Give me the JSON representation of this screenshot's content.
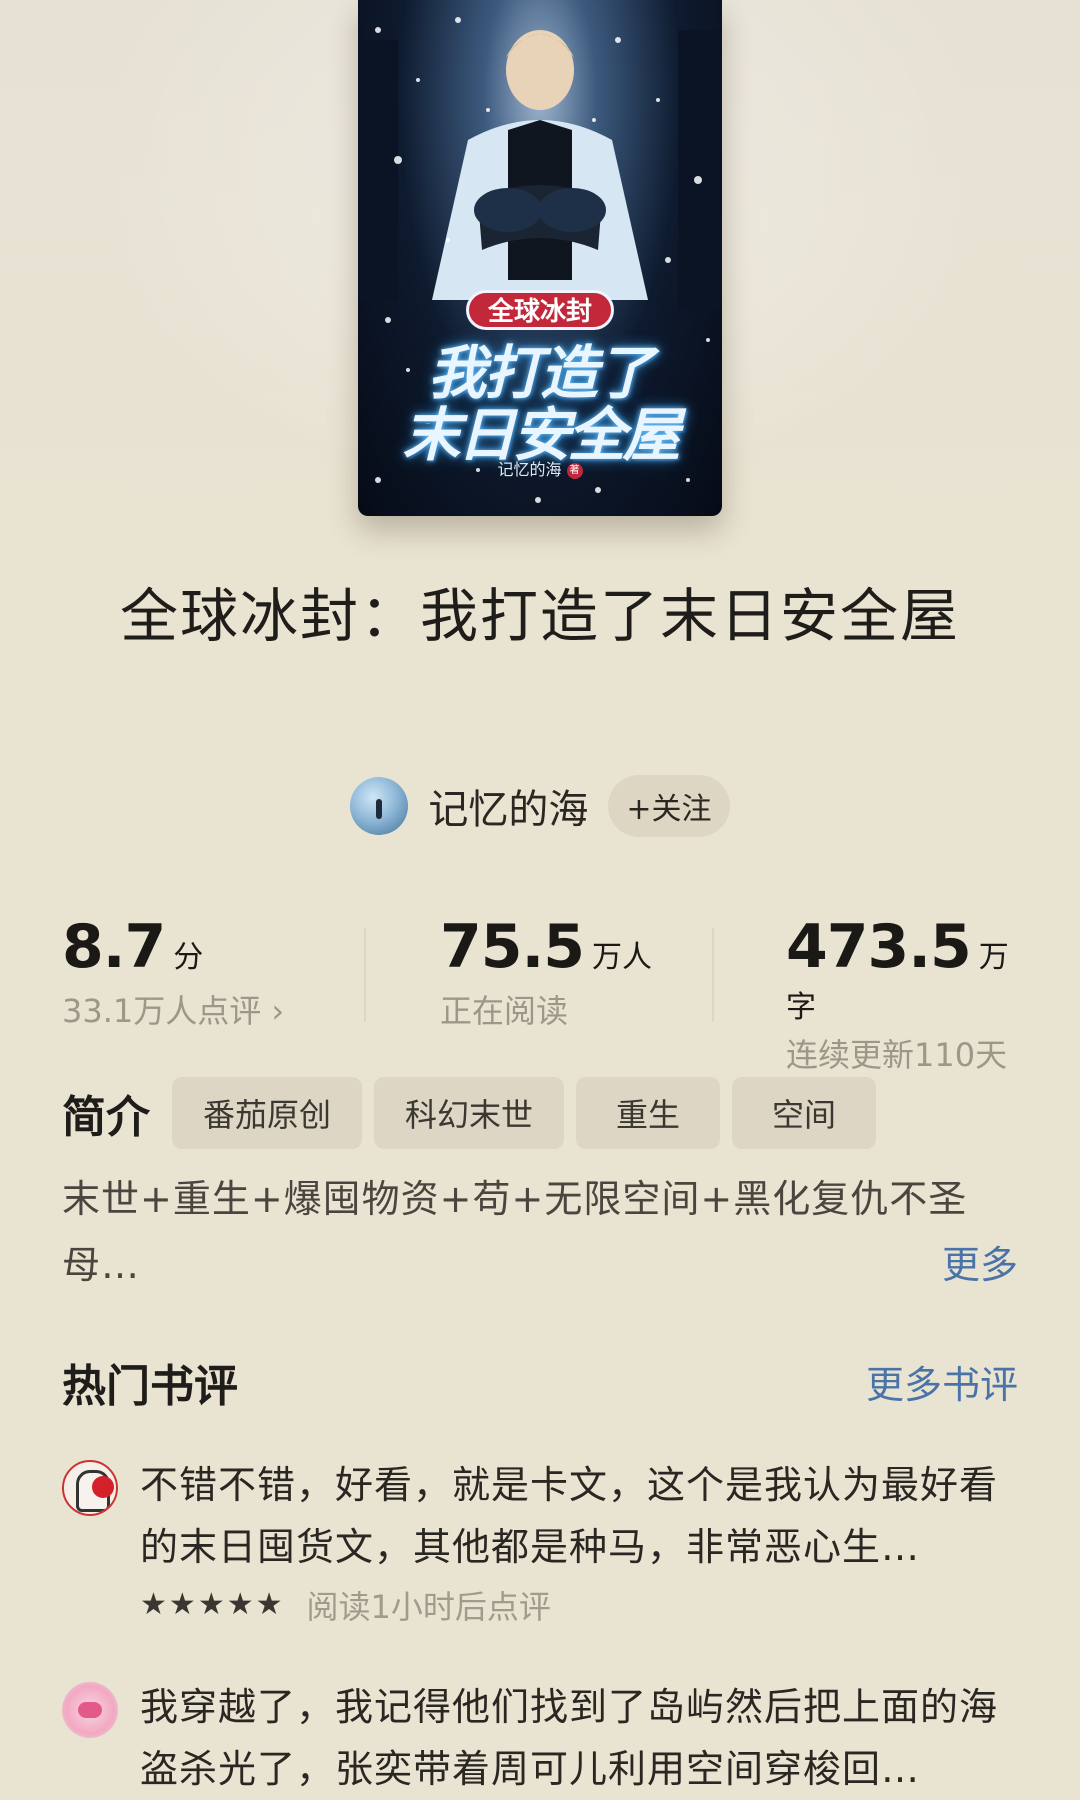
{
  "cover": {
    "series": "全球冰封",
    "title_line1": "我打造了",
    "title_line2": "末日安全屋",
    "author": "记忆的海"
  },
  "book": {
    "title": "全球冰封：我打造了末日安全屋"
  },
  "author": {
    "name": "记忆的海",
    "follow_label": "+关注"
  },
  "stats": {
    "rating": {
      "value": "8.7",
      "unit": "分",
      "sub": "33.1万人点评 ›"
    },
    "readers": {
      "value": "75.5",
      "unit": "万人",
      "sub": "正在阅读"
    },
    "words": {
      "value": "473.5",
      "unit": "万字",
      "sub": "连续更新110天"
    }
  },
  "intro": {
    "label": "简介",
    "tags": [
      "番茄原创",
      "科幻末世",
      "重生",
      "空间"
    ],
    "text": "末世+重生+爆囤物资+苟+无限空间+黑化复仇不圣母…",
    "more_label": "更多"
  },
  "reviews": {
    "title": "热门书评",
    "more_label": "更多书评",
    "items": [
      {
        "text": "不错不错，好看，就是卡文，这个是我认为最好看的末日囤货文，其他都是种马，非常恶心生…",
        "rating": 5,
        "note": "阅读1小时后点评"
      },
      {
        "text": "我穿越了，我记得他们找到了岛屿然后把上面的海盗杀光了，张奕带着周可儿利用空间穿梭回…"
      }
    ]
  }
}
